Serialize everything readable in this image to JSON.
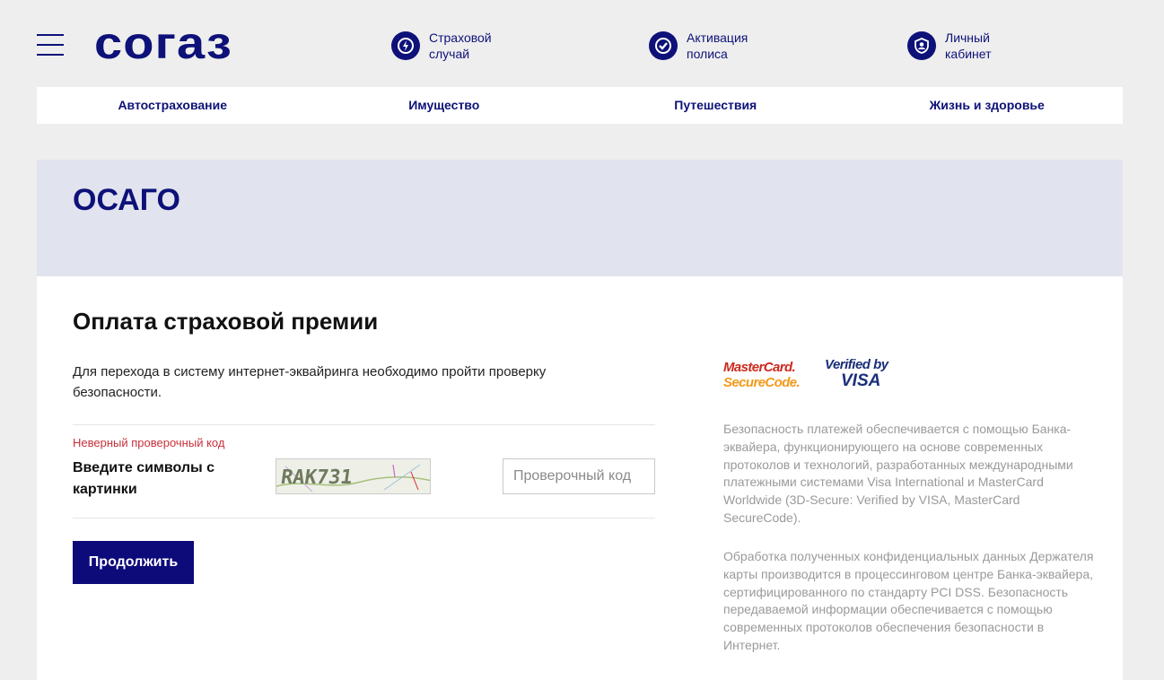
{
  "header": {
    "logo": "согаз",
    "quick_links": [
      {
        "line1": "Страховой",
        "line2": "случай",
        "icon": "bolt-icon"
      },
      {
        "line1": "Активация",
        "line2": "полиса",
        "icon": "check-shield-icon"
      },
      {
        "line1": "Личный",
        "line2": "кабинет",
        "icon": "user-shield-icon"
      }
    ]
  },
  "nav": {
    "items": [
      "Автострахование",
      "Имущество",
      "Путешествия",
      "Жизнь и здоровье"
    ]
  },
  "hero": {
    "title": "ОСАГО"
  },
  "payment": {
    "title": "Оплата страховой премии",
    "intro": "Для перехода в систему интернет-эквайринга необходимо пройти проверку безопасности.",
    "error": "Неверный проверочный код",
    "captcha_label": "Введите символы с картинки",
    "captcha_text": "RAK731",
    "code_placeholder": "Проверочный код",
    "code_value": "",
    "submit_label": "Продолжить"
  },
  "security": {
    "mastercard_line1": "MasterCard.",
    "mastercard_line2": "SecureCode.",
    "visa_line1": "Verified by",
    "visa_line2": "VISA",
    "text1": "Безопасность платежей обеспечивается с помощью Банка-эквайера, функционирующего на основе современных протоколов и технологий, разработанных международными платежными системами Visa International и MasterCard Worldwide (3D-Secure: Verified by VISA, MasterCard SecureCode).",
    "text2": "Обработка полученных конфиденциальных данных Держателя карты производится в процессинговом центре Банка-эквайера, сертифицированного по стандарту PCI DSS. Безопасность передаваемой информации обеспечивается с помощью современных протоколов обеспечения безопасности в Интернет."
  },
  "colors": {
    "brand": "#0d1178",
    "error": "#c8303b",
    "hero_bg": "#e1e4ee",
    "page_bg": "#eeeeee"
  }
}
